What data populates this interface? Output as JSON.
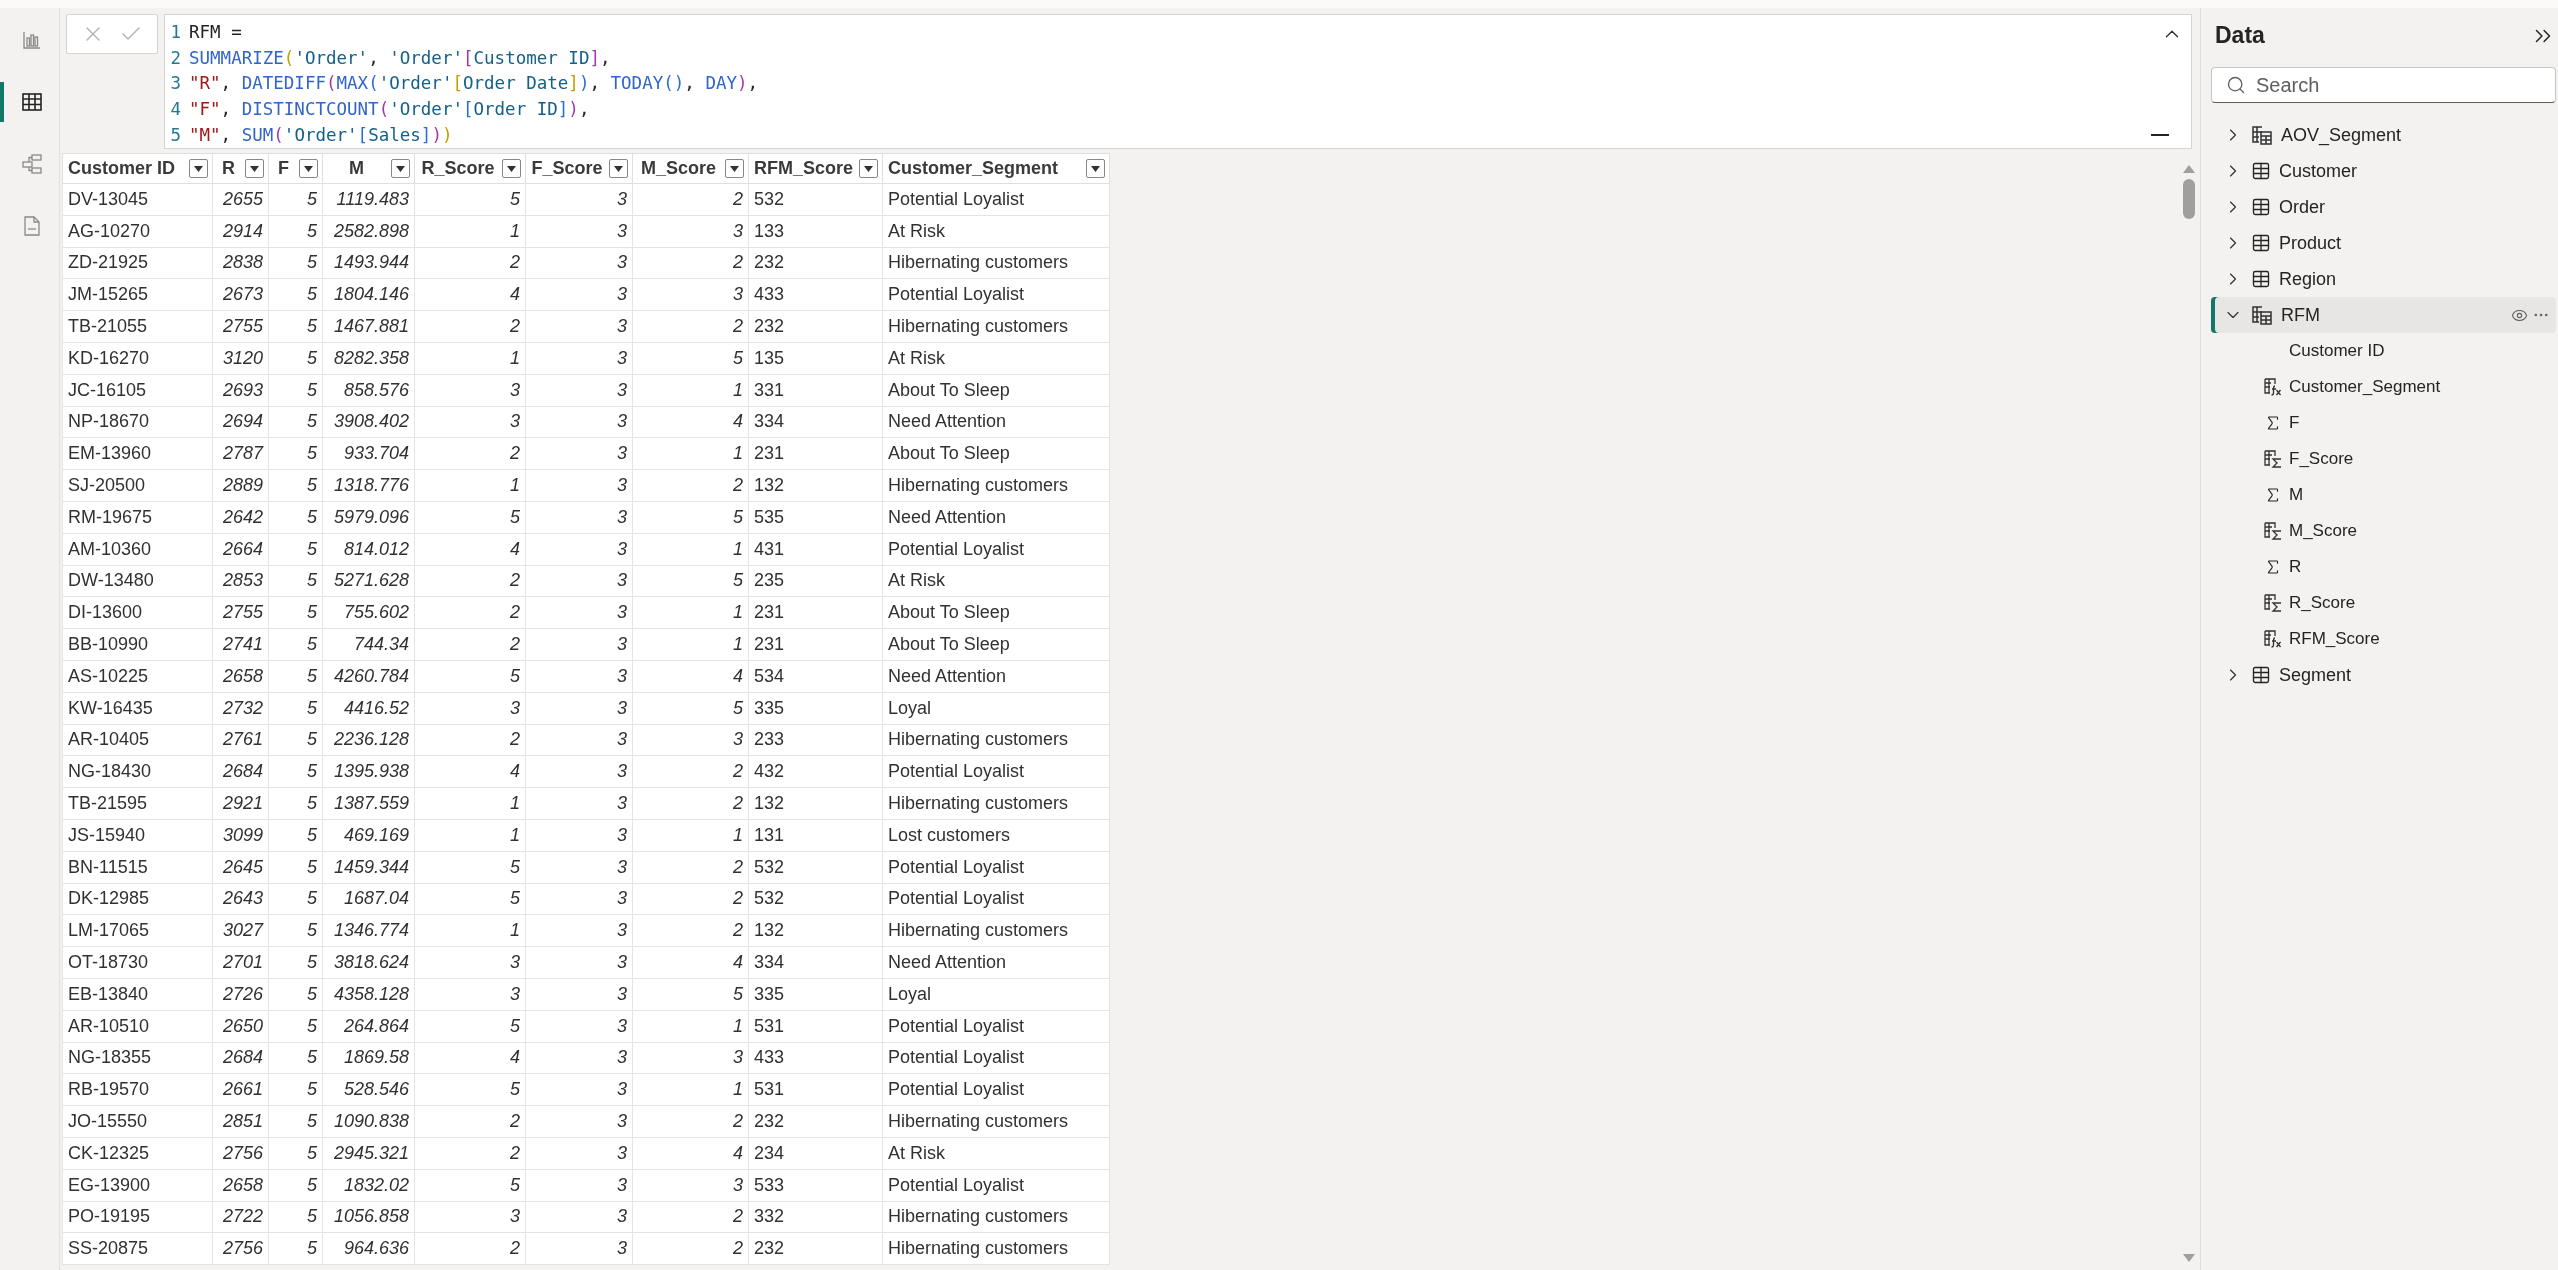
{
  "view_rail": [
    {
      "kind": "report",
      "selected": false
    },
    {
      "kind": "table",
      "selected": true
    },
    {
      "kind": "model",
      "selected": false
    },
    {
      "kind": "dax",
      "selected": false
    }
  ],
  "formula": {
    "lines": [
      {
        "number": "1",
        "tokens": [
          {
            "t": "RFM =",
            "kind": "plain"
          }
        ]
      },
      {
        "number": "2",
        "tokens": [
          {
            "t": "SUMMARIZE",
            "kind": "func"
          },
          {
            "t": "(",
            "kind": "br1"
          },
          {
            "t": "'Order'",
            "kind": "ref"
          },
          {
            "t": ", ",
            "kind": "plain"
          },
          {
            "t": "'Order'",
            "kind": "ref"
          },
          {
            "t": "[",
            "kind": "br2"
          },
          {
            "t": "Customer ID",
            "kind": "ref"
          },
          {
            "t": "]",
            "kind": "br2"
          },
          {
            "t": ",",
            "kind": "plain"
          }
        ]
      },
      {
        "number": "3",
        "tokens": [
          {
            "t": "\"R\"",
            "kind": "str"
          },
          {
            "t": ", ",
            "kind": "plain"
          },
          {
            "t": "DATEDIFF",
            "kind": "func"
          },
          {
            "t": "(",
            "kind": "br2"
          },
          {
            "t": "MAX",
            "kind": "func"
          },
          {
            "t": "(",
            "kind": "br3"
          },
          {
            "t": "'Order'",
            "kind": "ref"
          },
          {
            "t": "[",
            "kind": "br1"
          },
          {
            "t": "Order Date",
            "kind": "ref"
          },
          {
            "t": "]",
            "kind": "br1"
          },
          {
            "t": ")",
            "kind": "br3"
          },
          {
            "t": ", ",
            "kind": "plain"
          },
          {
            "t": "TODAY",
            "kind": "func"
          },
          {
            "t": "()",
            "kind": "br3"
          },
          {
            "t": ", ",
            "kind": "plain"
          },
          {
            "t": "DAY",
            "kind": "func"
          },
          {
            "t": ")",
            "kind": "br2"
          },
          {
            "t": ",",
            "kind": "plain"
          }
        ]
      },
      {
        "number": "4",
        "tokens": [
          {
            "t": "\"F\"",
            "kind": "str"
          },
          {
            "t": ", ",
            "kind": "plain"
          },
          {
            "t": "DISTINCTCOUNT",
            "kind": "func"
          },
          {
            "t": "(",
            "kind": "br2"
          },
          {
            "t": "'Order'",
            "kind": "ref"
          },
          {
            "t": "[",
            "kind": "br3"
          },
          {
            "t": "Order ID",
            "kind": "ref"
          },
          {
            "t": "]",
            "kind": "br3"
          },
          {
            "t": ")",
            "kind": "br2"
          },
          {
            "t": ",",
            "kind": "plain"
          }
        ]
      },
      {
        "number": "5",
        "tokens": [
          {
            "t": "\"M\"",
            "kind": "str"
          },
          {
            "t": ", ",
            "kind": "plain"
          },
          {
            "t": "SUM",
            "kind": "func"
          },
          {
            "t": "(",
            "kind": "br2"
          },
          {
            "t": "'Order'",
            "kind": "ref"
          },
          {
            "t": "[",
            "kind": "br3"
          },
          {
            "t": "Sales",
            "kind": "ref"
          },
          {
            "t": "]",
            "kind": "br3"
          },
          {
            "t": ")",
            "kind": "br2"
          },
          {
            "t": ")",
            "kind": "br1"
          }
        ]
      }
    ]
  },
  "table": {
    "columns": [
      {
        "name": "Customer ID",
        "kind": "text"
      },
      {
        "name": "R",
        "kind": "number"
      },
      {
        "name": "F",
        "kind": "number"
      },
      {
        "name": "M",
        "kind": "number"
      },
      {
        "name": "R_Score",
        "kind": "number"
      },
      {
        "name": "F_Score",
        "kind": "number"
      },
      {
        "name": "M_Score",
        "kind": "number"
      },
      {
        "name": "RFM_Score",
        "kind": "text"
      },
      {
        "name": "Customer_Segment",
        "kind": "text"
      }
    ],
    "rows": [
      [
        "DV-13045",
        "2655",
        "5",
        "1119.483",
        "5",
        "3",
        "2",
        "532",
        "Potential Loyalist"
      ],
      [
        "AG-10270",
        "2914",
        "5",
        "2582.898",
        "1",
        "3",
        "3",
        "133",
        "At Risk"
      ],
      [
        "ZD-21925",
        "2838",
        "5",
        "1493.944",
        "2",
        "3",
        "2",
        "232",
        "Hibernating customers"
      ],
      [
        "JM-15265",
        "2673",
        "5",
        "1804.146",
        "4",
        "3",
        "3",
        "433",
        "Potential Loyalist"
      ],
      [
        "TB-21055",
        "2755",
        "5",
        "1467.881",
        "2",
        "3",
        "2",
        "232",
        "Hibernating customers"
      ],
      [
        "KD-16270",
        "3120",
        "5",
        "8282.358",
        "1",
        "3",
        "5",
        "135",
        "At Risk"
      ],
      [
        "JC-16105",
        "2693",
        "5",
        "858.576",
        "3",
        "3",
        "1",
        "331",
        "About To Sleep"
      ],
      [
        "NP-18670",
        "2694",
        "5",
        "3908.402",
        "3",
        "3",
        "4",
        "334",
        "Need Attention"
      ],
      [
        "EM-13960",
        "2787",
        "5",
        "933.704",
        "2",
        "3",
        "1",
        "231",
        "About To Sleep"
      ],
      [
        "SJ-20500",
        "2889",
        "5",
        "1318.776",
        "1",
        "3",
        "2",
        "132",
        "Hibernating customers"
      ],
      [
        "RM-19675",
        "2642",
        "5",
        "5979.096",
        "5",
        "3",
        "5",
        "535",
        "Need Attention"
      ],
      [
        "AM-10360",
        "2664",
        "5",
        "814.012",
        "4",
        "3",
        "1",
        "431",
        "Potential Loyalist"
      ],
      [
        "DW-13480",
        "2853",
        "5",
        "5271.628",
        "2",
        "3",
        "5",
        "235",
        "At Risk"
      ],
      [
        "DI-13600",
        "2755",
        "5",
        "755.602",
        "2",
        "3",
        "1",
        "231",
        "About To Sleep"
      ],
      [
        "BB-10990",
        "2741",
        "5",
        "744.34",
        "2",
        "3",
        "1",
        "231",
        "About To Sleep"
      ],
      [
        "AS-10225",
        "2658",
        "5",
        "4260.784",
        "5",
        "3",
        "4",
        "534",
        "Need Attention"
      ],
      [
        "KW-16435",
        "2732",
        "5",
        "4416.52",
        "3",
        "3",
        "5",
        "335",
        "Loyal"
      ],
      [
        "AR-10405",
        "2761",
        "5",
        "2236.128",
        "2",
        "3",
        "3",
        "233",
        "Hibernating customers"
      ],
      [
        "NG-18430",
        "2684",
        "5",
        "1395.938",
        "4",
        "3",
        "2",
        "432",
        "Potential Loyalist"
      ],
      [
        "TB-21595",
        "2921",
        "5",
        "1387.559",
        "1",
        "3",
        "2",
        "132",
        "Hibernating customers"
      ],
      [
        "JS-15940",
        "3099",
        "5",
        "469.169",
        "1",
        "3",
        "1",
        "131",
        "Lost customers"
      ],
      [
        "BN-11515",
        "2645",
        "5",
        "1459.344",
        "5",
        "3",
        "2",
        "532",
        "Potential Loyalist"
      ],
      [
        "DK-12985",
        "2643",
        "5",
        "1687.04",
        "5",
        "3",
        "2",
        "532",
        "Potential Loyalist"
      ],
      [
        "LM-17065",
        "3027",
        "5",
        "1346.774",
        "1",
        "3",
        "2",
        "132",
        "Hibernating customers"
      ],
      [
        "OT-18730",
        "2701",
        "5",
        "3818.624",
        "3",
        "3",
        "4",
        "334",
        "Need Attention"
      ],
      [
        "EB-13840",
        "2726",
        "5",
        "4358.128",
        "3",
        "3",
        "5",
        "335",
        "Loyal"
      ],
      [
        "AR-10510",
        "2650",
        "5",
        "264.864",
        "5",
        "3",
        "1",
        "531",
        "Potential Loyalist"
      ],
      [
        "NG-18355",
        "2684",
        "5",
        "1869.58",
        "4",
        "3",
        "3",
        "433",
        "Potential Loyalist"
      ],
      [
        "RB-19570",
        "2661",
        "5",
        "528.546",
        "5",
        "3",
        "1",
        "531",
        "Potential Loyalist"
      ],
      [
        "JO-15550",
        "2851",
        "5",
        "1090.838",
        "2",
        "3",
        "2",
        "232",
        "Hibernating customers"
      ],
      [
        "CK-12325",
        "2756",
        "5",
        "2945.321",
        "2",
        "3",
        "4",
        "234",
        "At Risk"
      ],
      [
        "EG-13900",
        "2658",
        "5",
        "1832.02",
        "5",
        "3",
        "3",
        "533",
        "Potential Loyalist"
      ],
      [
        "PO-19195",
        "2722",
        "5",
        "1056.858",
        "3",
        "3",
        "2",
        "332",
        "Hibernating customers"
      ],
      [
        "SS-20875",
        "2756",
        "5",
        "964.636",
        "2",
        "3",
        "2",
        "232",
        "Hibernating customers"
      ]
    ]
  },
  "data_pane": {
    "title": "Data",
    "search": {
      "placeholder": "Search"
    },
    "tables": [
      {
        "name": "AOV_Segment",
        "kind": "calculated-table",
        "expanded": false,
        "selected": false
      },
      {
        "name": "Customer",
        "kind": "table",
        "expanded": false,
        "selected": false
      },
      {
        "name": "Order",
        "kind": "table",
        "expanded": false,
        "selected": false
      },
      {
        "name": "Product",
        "kind": "table",
        "expanded": false,
        "selected": false
      },
      {
        "name": "Region",
        "kind": "table",
        "expanded": false,
        "selected": false
      },
      {
        "name": "RFM",
        "kind": "calculated-table",
        "expanded": true,
        "selected": true,
        "children": [
          {
            "name": "Customer ID",
            "kind": "plain"
          },
          {
            "name": "Customer_Segment",
            "kind": "calculated"
          },
          {
            "name": "F",
            "kind": "sum"
          },
          {
            "name": "F_Score",
            "kind": "calculated-sum"
          },
          {
            "name": "M",
            "kind": "sum"
          },
          {
            "name": "M_Score",
            "kind": "calculated-sum"
          },
          {
            "name": "R",
            "kind": "sum"
          },
          {
            "name": "R_Score",
            "kind": "calculated-sum"
          },
          {
            "name": "RFM_Score",
            "kind": "calculated"
          }
        ]
      },
      {
        "name": "Segment",
        "kind": "table",
        "expanded": false,
        "selected": false
      }
    ]
  }
}
